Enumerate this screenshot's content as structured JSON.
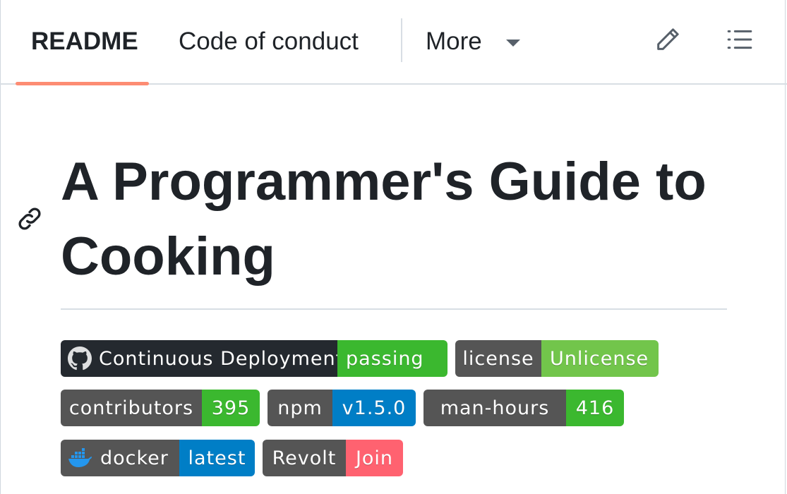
{
  "tabs": {
    "readme": "README",
    "code_of_conduct": "Code of conduct",
    "more": "More",
    "edit_icon": "pencil-icon",
    "outline_icon": "list-icon"
  },
  "heading": {
    "title": "A Programmer's Guide to Cooking",
    "anchor_icon": "link-icon"
  },
  "badges": [
    {
      "label": "Continuous Deployment",
      "value": "passing",
      "color": "#3bb82f",
      "logo": "github-icon"
    },
    {
      "label": "license",
      "value": "Unlicense",
      "color": "#72c54b"
    },
    {
      "label": "contributors",
      "value": "395",
      "color": "#3bb82f"
    },
    {
      "label": "npm",
      "value": "v1.5.0",
      "color": "#007ec6"
    },
    {
      "label": "man-hours",
      "value": "416",
      "color": "#3bb82f"
    },
    {
      "label": "docker",
      "value": "latest",
      "color": "#007ec6",
      "logo": "docker-icon"
    },
    {
      "label": "Revolt",
      "value": "Join",
      "color": "#ff6270"
    }
  ],
  "colors": {
    "accent_underline": "#fd8c73",
    "text": "#1f2328",
    "badge_label_bg": "#555555"
  }
}
